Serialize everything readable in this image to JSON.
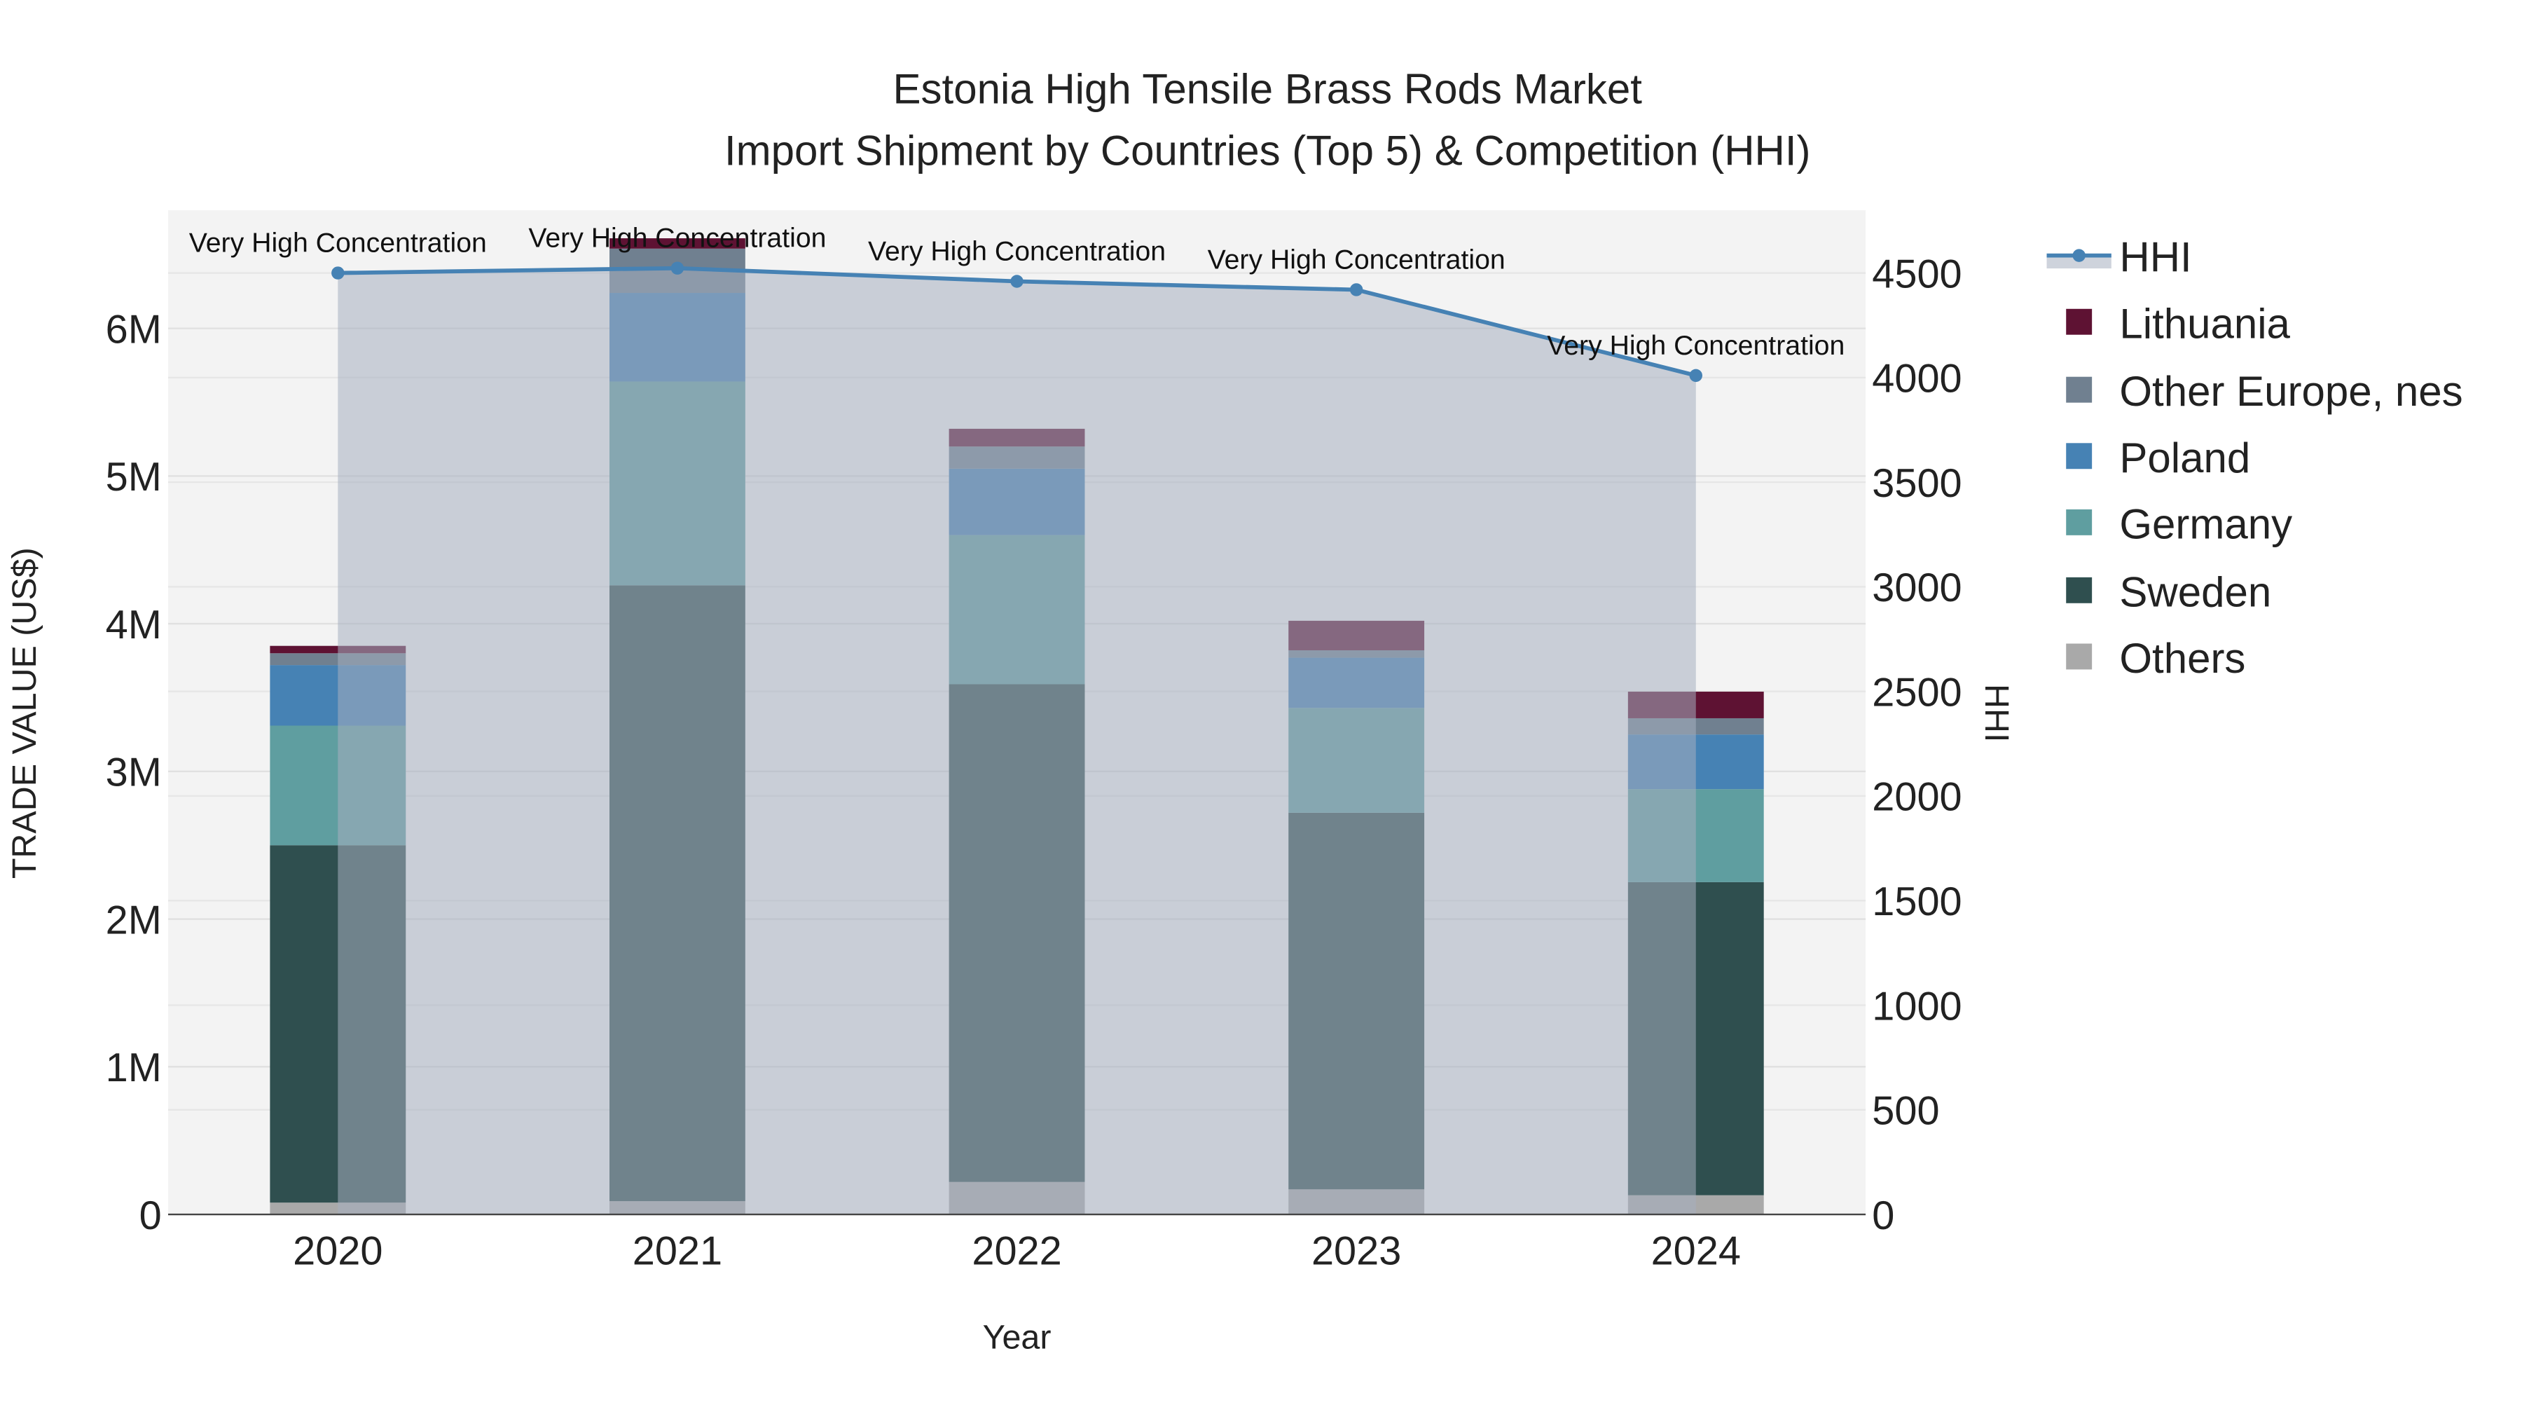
{
  "chart_data": {
    "type": "bar",
    "title": "Estonia High Tensile Brass Rods Market",
    "subtitle": "Import Shipment by Countries (Top 5) & Competition (HHI)",
    "xlabel": "Year",
    "ylabel": "TRADE VALUE (US$)",
    "y2label": "HHI",
    "categories": [
      "2020",
      "2021",
      "2022",
      "2023",
      "2024"
    ],
    "ylim": [
      0,
      6800000
    ],
    "y2lim": [
      0,
      4800
    ],
    "yticks": [
      {
        "v": 0,
        "label": "0"
      },
      {
        "v": 1000000,
        "label": "1M"
      },
      {
        "v": 2000000,
        "label": "2M"
      },
      {
        "v": 3000000,
        "label": "3M"
      },
      {
        "v": 4000000,
        "label": "4M"
      },
      {
        "v": 5000000,
        "label": "5M"
      },
      {
        "v": 6000000,
        "label": "6M"
      }
    ],
    "y2ticks": [
      {
        "v": 0,
        "label": "0"
      },
      {
        "v": 500,
        "label": "500"
      },
      {
        "v": 1000,
        "label": "1000"
      },
      {
        "v": 1500,
        "label": "1500"
      },
      {
        "v": 2000,
        "label": "2000"
      },
      {
        "v": 2500,
        "label": "2500"
      },
      {
        "v": 3000,
        "label": "3000"
      },
      {
        "v": 3500,
        "label": "3500"
      },
      {
        "v": 4000,
        "label": "4000"
      },
      {
        "v": 4500,
        "label": "4500"
      }
    ],
    "stacking": "stacked",
    "series": [
      {
        "name": "Others",
        "color": "#a9a9a9",
        "values": [
          80000,
          90000,
          220000,
          170000,
          130000
        ]
      },
      {
        "name": "Sweden",
        "color": "#2f4f4f",
        "values": [
          2420000,
          4170000,
          3370000,
          2550000,
          2120000
        ]
      },
      {
        "name": "Germany",
        "color": "#5f9ea0",
        "values": [
          810000,
          1380000,
          1010000,
          710000,
          630000
        ]
      },
      {
        "name": "Poland",
        "color": "#4682b4",
        "values": [
          410000,
          600000,
          450000,
          340000,
          370000
        ]
      },
      {
        "name": "Other Europe, nes",
        "color": "#708090",
        "values": [
          80000,
          300000,
          150000,
          50000,
          110000
        ]
      },
      {
        "name": "Lithuania",
        "color": "#5e1233",
        "values": [
          50000,
          70000,
          120000,
          200000,
          180000
        ]
      }
    ],
    "hhi": {
      "name": "HHI",
      "color": "#4682b4",
      "values": [
        4500,
        4523,
        4460,
        4420,
        4010
      ]
    },
    "annotations": [
      "Very High Concentration",
      "Very High Concentration",
      "Very High Concentration",
      "Very High Concentration",
      "Very High Concentration"
    ],
    "legend": {
      "placement": "right",
      "order": [
        "HHI",
        "Lithuania",
        "Other Europe, nes",
        "Poland",
        "Germany",
        "Sweden",
        "Others"
      ]
    },
    "grid": true
  }
}
